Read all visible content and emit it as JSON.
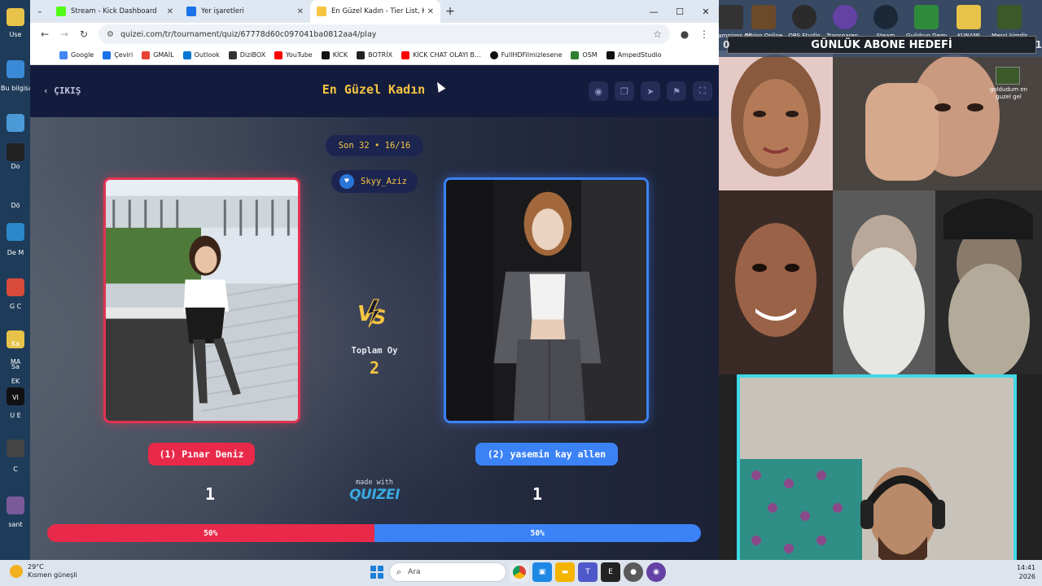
{
  "browser": {
    "tabs": [
      {
        "label": "Stream - Kick Dashboard",
        "active": false,
        "favicon_color": "#53fc18"
      },
      {
        "label": "Yer işaretleri",
        "active": false,
        "favicon_color": "#1a73e8"
      },
      {
        "label": "En Güzel Kadın - Tier List, Kör S",
        "active": true,
        "favicon_color": "#f5c542"
      }
    ],
    "url": "quizei.com/tr/tournament/quiz/67778d60c097041ba0812aa4/play",
    "bookmarks": [
      {
        "label": "Google",
        "color": "#4285f4"
      },
      {
        "label": "Çeviri",
        "color": "#1a73e8"
      },
      {
        "label": "GMAİL",
        "color": "#ea4335"
      },
      {
        "label": "Outlook",
        "color": "#0078d4"
      },
      {
        "label": "DiziBOX",
        "color": "#333333"
      },
      {
        "label": "YouTube",
        "color": "#ff0000"
      },
      {
        "label": "KİCK",
        "color": "#111111"
      },
      {
        "label": "BOTRİX",
        "color": "#222222"
      },
      {
        "label": "KİCK CHAT OLAYI B...",
        "color": "#ff0000"
      },
      {
        "label": "FullHDFilmizlesene",
        "color": "#111111"
      },
      {
        "label": "OSM",
        "color": "#2e7d32"
      },
      {
        "label": "AmpedStudio",
        "color": "#111111"
      }
    ]
  },
  "quiz": {
    "exit_label": "ÇIKIŞ",
    "title": "En Güzel Kadın",
    "round_label": "Son 32 • 16/16",
    "username": "Skyy_Aziz",
    "total_label": "Toplam Oy",
    "total_value": "2",
    "left": {
      "name": "(1) Pınar Deniz",
      "votes": "1",
      "percent_label": "50%",
      "percent": 50
    },
    "right": {
      "name": "(2) yasemin kay allen",
      "votes": "1",
      "percent_label": "50%",
      "percent": 50
    },
    "made_with": "made with",
    "logo": "QUIZEI",
    "colors": {
      "accent": "#f5c542",
      "left": "#e8294a",
      "right": "#3b82f6"
    }
  },
  "overlay": {
    "goal_text": "GÜNLÜK ABONE HEDEFİ",
    "goal_left": "0",
    "goal_right": "1",
    "desktop_icons": [
      {
        "label": "Champions Online",
        "color": "#333333"
      },
      {
        "label": "Albion Online",
        "color": "#6b4a2a"
      },
      {
        "label": "OBS Studio",
        "color": "#2b2b2b"
      },
      {
        "label": "Transparen...",
        "color": "#6441a5"
      },
      {
        "label": "Steam",
        "color": "#1b2838"
      },
      {
        "label": "Guildrun Demo",
        "color": "#2f8a3c"
      },
      {
        "label": "KUNAMI",
        "color": "#e8c34a"
      },
      {
        "label": "Messi kimdir",
        "color": "#3a5a2a"
      }
    ],
    "file_label": "goldudum en guzel gel"
  },
  "left_desktop": {
    "labels": [
      "Use",
      "Bu bilgisa",
      "Do",
      "Dö",
      "De M",
      "G C",
      "Ka",
      "MA",
      "Sa",
      "EK",
      "VI",
      "U E",
      "C",
      "sant"
    ]
  },
  "taskbar": {
    "weather_temp": "29°C",
    "weather_desc": "Kısmen güneşli",
    "search_placeholder": "Ara",
    "clock_time": "14:41",
    "clock_year": "2026"
  }
}
